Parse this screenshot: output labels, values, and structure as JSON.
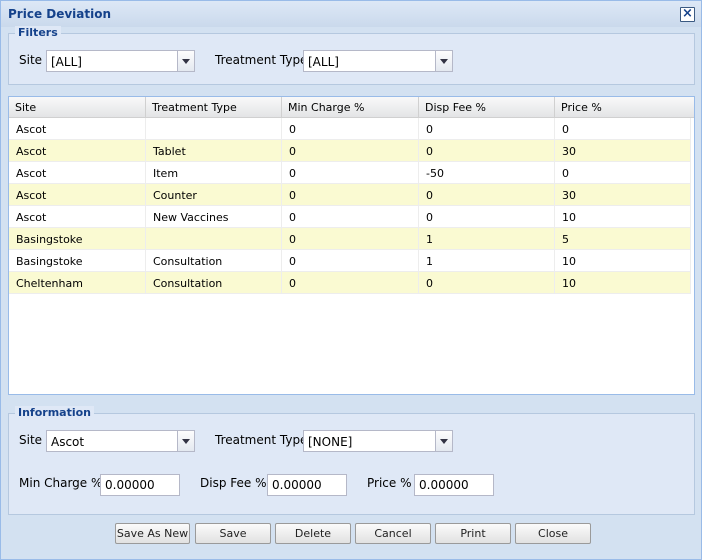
{
  "window": {
    "title": "Price Deviation"
  },
  "filters": {
    "legend": "Filters",
    "site_label": "Site",
    "site_value": "[ALL]",
    "treatment_label": "Treatment Type",
    "treatment_value": "[ALL]"
  },
  "grid": {
    "columns": [
      "Site",
      "Treatment Type",
      "Min Charge %",
      "Disp Fee %",
      "Price %"
    ],
    "rows": [
      [
        "Ascot",
        "",
        "0",
        "0",
        "0"
      ],
      [
        "Ascot",
        "Tablet",
        "0",
        "0",
        "30"
      ],
      [
        "Ascot",
        "Item",
        "0",
        "-50",
        "0"
      ],
      [
        "Ascot",
        "Counter",
        "0",
        "0",
        "30"
      ],
      [
        "Ascot",
        "New Vaccines",
        "0",
        "0",
        "10"
      ],
      [
        "Basingstoke",
        "",
        "0",
        "1",
        "5"
      ],
      [
        "Basingstoke",
        "Consultation",
        "0",
        "1",
        "10"
      ],
      [
        "Cheltenham",
        "Consultation",
        "0",
        "0",
        "10"
      ]
    ]
  },
  "information": {
    "legend": "Information",
    "site_label": "Site",
    "site_value": "Ascot",
    "treatment_label": "Treatment Type",
    "treatment_value": "[NONE]",
    "min_charge_label": "Min Charge %",
    "min_charge_value": "0.00000",
    "disp_fee_label": "Disp Fee %",
    "disp_fee_value": "0.00000",
    "price_label": "Price %",
    "price_value": "0.00000"
  },
  "buttons": {
    "save_as_new": "Save As New",
    "save": "Save",
    "delete": "Delete",
    "cancel": "Cancel",
    "print": "Print",
    "close": "Close"
  },
  "colors": {
    "title": "#15428b",
    "alt_row": "#fafad2",
    "panel": "#dfe8f6"
  },
  "icons": {
    "close": "close-icon",
    "dropdown": "chevron-down-icon"
  }
}
